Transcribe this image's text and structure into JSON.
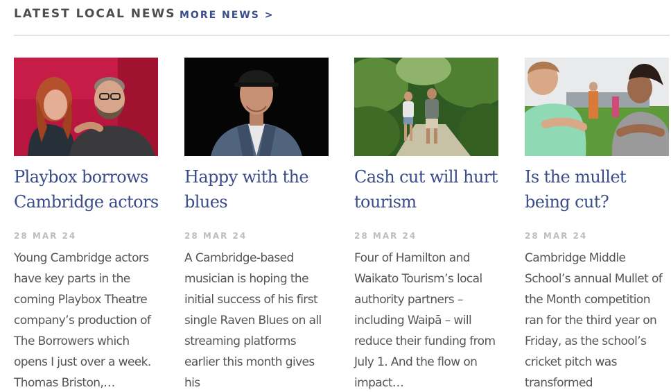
{
  "header": {
    "title": "LATEST LOCAL NEWS",
    "more_link": "MORE NEWS >"
  },
  "articles": [
    {
      "title": "Playbox borrows Cambridge actors",
      "date": "28 MAR 24",
      "summary": "Young Cambridge actors have key parts in the coming Playbox Theatre company’s production of The Borrowers which opens I just over a week. Thomas Briston,…",
      "image": "photo of two people posing against a red wall"
    },
    {
      "title": "Happy with the blues",
      "date": "28 MAR 24",
      "summary": "A Cambridge-based musician is hoping the initial success of his first single Raven Blues on all streaming platforms earlier this month gives his",
      "image": "photo of a man in a black cap and denim jacket"
    },
    {
      "title": "Cash cut will hurt tourism",
      "date": "28 MAR 24",
      "summary": "Four of Hamilton and Waikato Tourism’s local authority partners – including Waipā – will reduce their funding from July 1. And the flow on impact…",
      "image": "photo of hikers walking a bush track"
    },
    {
      "title": "Is the mullet being cut?",
      "date": "28 MAR 24",
      "summary": "Cambridge Middle School’s annual Mullet of the Month competition ran for the third year on Friday, as the school’s cricket pitch was transformed",
      "image": "photo of two students with arms crossed on a school field"
    }
  ],
  "colors": {
    "link": "#3b4c8a",
    "date": "#bdbdbd",
    "body_text": "#555555",
    "header_text": "#4d4d4d",
    "divider": "#e3e3e3"
  }
}
